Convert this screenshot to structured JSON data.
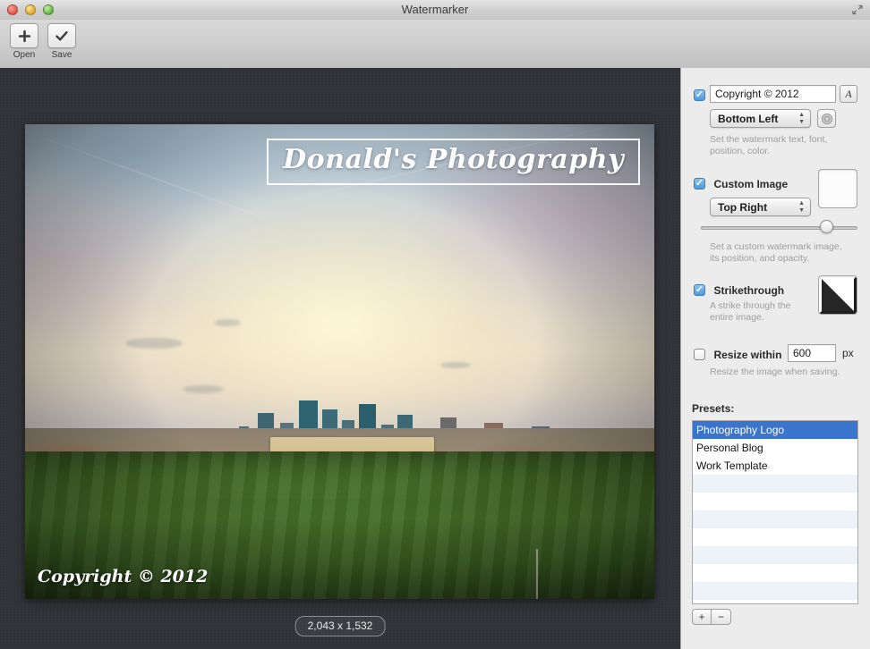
{
  "window": {
    "title": "Watermarker",
    "fullscreen_icon": "fullscreen-icon"
  },
  "toolbar": {
    "items": [
      {
        "label": "Open",
        "icon": "plus-icon",
        "glyph": "✚"
      },
      {
        "label": "Save",
        "icon": "checkmark-icon",
        "glyph": "✔"
      }
    ]
  },
  "canvas": {
    "dimensions_badge": "2,043 x 1,532",
    "watermark_image_text": "Donald's Photography",
    "watermark_text": "Copyright © 2012"
  },
  "sidebar": {
    "text_watermark": {
      "enabled": true,
      "value": "Copyright © 2012",
      "font_button_glyph": "A",
      "font_button_icon": "font-picker-icon",
      "position": "Bottom Left",
      "color_button_icon": "color-wheel-icon",
      "help": "Set the watermark text, font, position, color."
    },
    "custom_image": {
      "enabled": true,
      "label": "Custom Image",
      "position": "Top Right",
      "opacity_percent": 80,
      "help": "Set a custom watermark image, its position, and opacity."
    },
    "strikethrough": {
      "enabled": true,
      "label": "Strikethrough",
      "help": "A strike through the entire image."
    },
    "resize": {
      "enabled": false,
      "label": "Resize within",
      "value": "600",
      "unit": "px",
      "help": "Resize the image when saving."
    },
    "presets": {
      "label": "Presets:",
      "items": [
        {
          "label": "Photography Logo",
          "selected": true
        },
        {
          "label": "Personal Blog",
          "selected": false
        },
        {
          "label": "Work Template",
          "selected": false
        }
      ],
      "add_button": "+",
      "remove_button": "−"
    }
  },
  "colors": {
    "selection_blue": "#3a74cd",
    "checkbox_blue": "#4a9ade",
    "canvas_background": "#31343a",
    "sidebar_background": "#ececec",
    "help_text": "#9d9d9d"
  }
}
